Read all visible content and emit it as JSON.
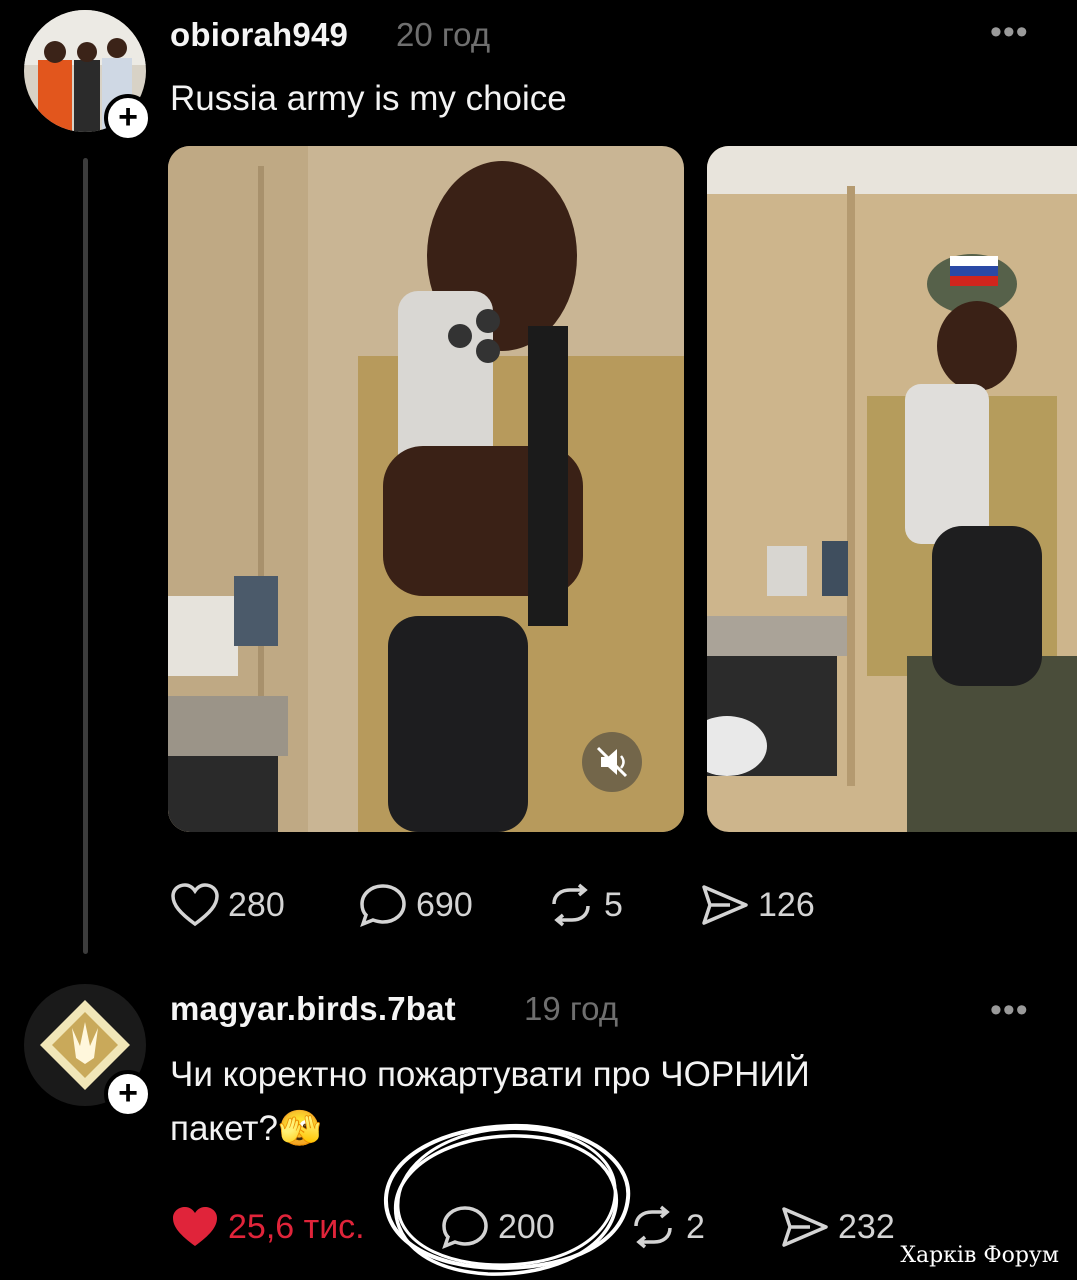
{
  "post1": {
    "username": "obiorah949",
    "time": "20 год",
    "text": "Russia army is my choice",
    "more": "•••",
    "stats": {
      "likes": "280",
      "comments": "690",
      "reposts": "5",
      "shares": "126"
    }
  },
  "post2": {
    "username": "magyar.birds.7bat",
    "time": "19 год",
    "text_line1": "Чи коректно пожартувати про ЧОРНИЙ",
    "text_line2": "пакет?",
    "emoji": "🫣",
    "more": "•••",
    "stats": {
      "likes": "25,6 тис.",
      "comments": "200",
      "reposts": "2",
      "shares": "232"
    }
  },
  "watermark": "Харків Форум",
  "colors": {
    "background": "#000000",
    "like_active": "#e0243a",
    "muted_text": "#6f6f6f",
    "scribble": "#ffffff"
  }
}
